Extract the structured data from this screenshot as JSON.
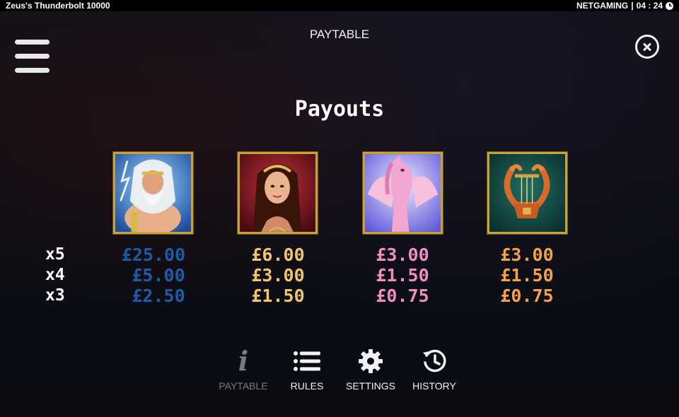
{
  "top_bar": {
    "game_title": "Zeus's Thunderbolt 10000",
    "brand": "NETGAMING",
    "separator": "|",
    "time": "04 : 24",
    "clock_icon": "clock-icon"
  },
  "header": {
    "title": "PAYTABLE",
    "menu_icon": "hamburger-menu-icon",
    "close_icon": "close-circle-icon"
  },
  "section_title": "Payouts",
  "multipliers": [
    "x5",
    "x4",
    "x3"
  ],
  "symbols": [
    {
      "name": "zeus",
      "icon": "zeus-icon",
      "color": "#1f5aa6",
      "payouts": [
        "£25.00",
        "£5.00",
        "£2.50"
      ]
    },
    {
      "name": "goddess",
      "icon": "goddess-icon",
      "color": "#f2c46e",
      "payouts": [
        "£6.00",
        "£3.00",
        "£1.50"
      ]
    },
    {
      "name": "pegasus",
      "icon": "pegasus-icon",
      "color": "#f08ec4",
      "payouts": [
        "£3.00",
        "£1.50",
        "£0.75"
      ]
    },
    {
      "name": "lyre",
      "icon": "lyre-icon",
      "color": "#f2a24a",
      "payouts": [
        "£3.00",
        "£1.50",
        "£0.75"
      ]
    }
  ],
  "nav": [
    {
      "label": "PAYTABLE",
      "icon": "info-icon",
      "active": true
    },
    {
      "label": "RULES",
      "icon": "list-icon",
      "active": false
    },
    {
      "label": "SETTINGS",
      "icon": "gear-icon",
      "active": false
    },
    {
      "label": "HISTORY",
      "icon": "history-icon",
      "active": false
    }
  ],
  "colors": {
    "background": "#0d0f16",
    "frame_gold": "#c9a13b",
    "inactive_text": "#7a7b80"
  }
}
